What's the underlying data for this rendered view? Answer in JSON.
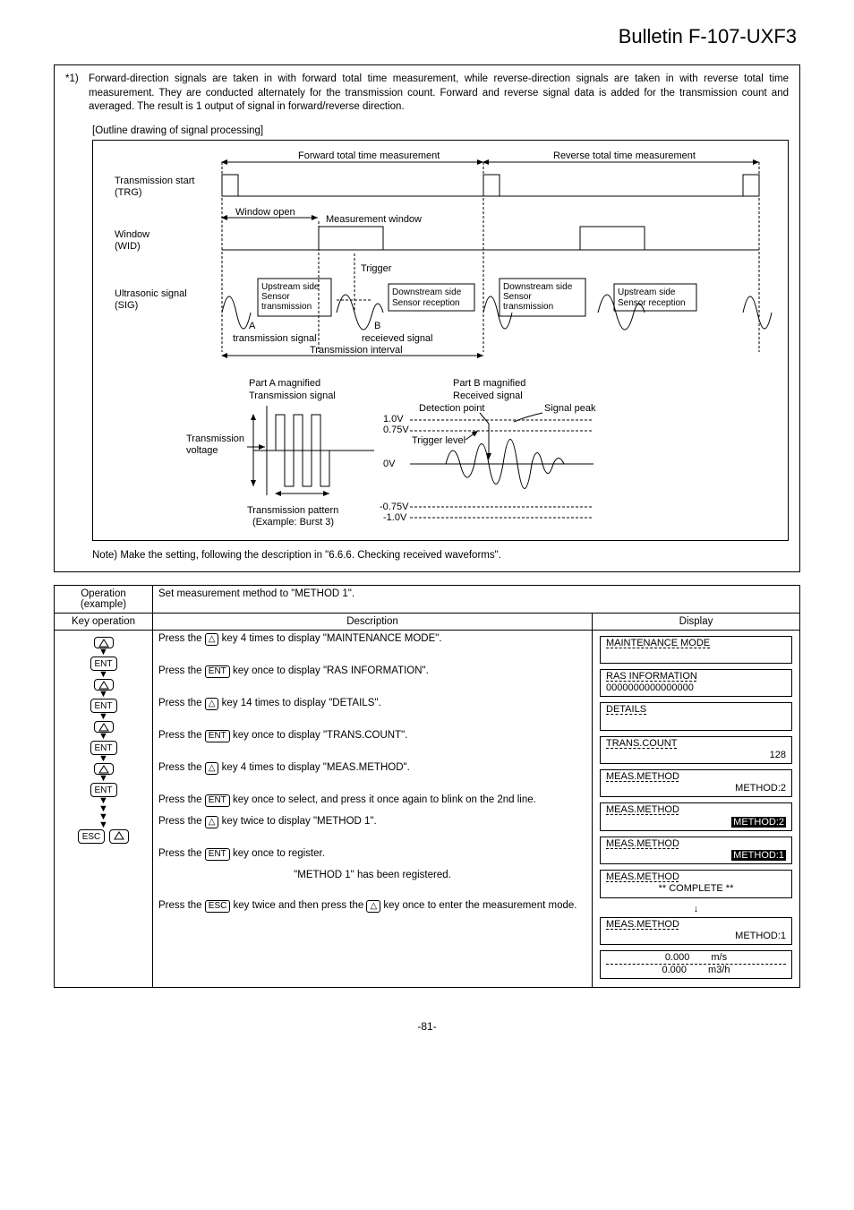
{
  "header": {
    "title": "Bulletin F-107-UXF3"
  },
  "note1": {
    "star": "*1)",
    "text": "Forward-direction signals are taken in with forward total time measurement, while reverse-direction signals are taken in with reverse total time measurement. They are conducted alternately for the transmission count. Forward and reverse signal data is added for the transmission count and averaged. The result is 1 output of signal in forward/reverse direction."
  },
  "outline_caption": "[Outline drawing of signal processing]",
  "diagram": {
    "fwd_total": "Forward total time measurement",
    "rev_total": "Reverse total time measurement",
    "trg_label": "Transmission start\n(TRG)",
    "wid_label": "Window\n(WID)",
    "sig_label": "Ultrasonic signal\n(SIG)",
    "window_open": "Window open",
    "meas_window": "Measurement window",
    "trigger": "Trigger",
    "up_sensor_tx": "Upstream side\nSensor\ntransmission",
    "dn_sensor_rx": "Downstream side\nSensor reception",
    "dn_sensor_tx": "Downstream side\nSensor\ntransmission",
    "up_sensor_rx": "Upstream side\nSensor reception",
    "a_label": "A\ntransmission signal",
    "b_label": "B\nreceieved signal",
    "trans_interval": "Transmission interval",
    "partA": "Part A magnified\nTransmission signal",
    "partB": "Part B magnified\nReceived signal",
    "tx_voltage": "Transmission\nvoltage",
    "tx_pattern": "Transmission pattern\n(Example: Burst 3)",
    "detection": "Detection point",
    "sig_peak": "Signal peak",
    "trig_level": "Trigger level",
    "v10": "1.0V",
    "v075": "0.75V",
    "v0": "0V",
    "vn075": "-0.75V",
    "vn10": "-1.0V"
  },
  "bottom_note": "Note) Make the setting, following the description in \"6.6.6. Checking received waveforms\".",
  "ops": {
    "operation_label": "Operation\n(example)",
    "set_method": "Set measurement method to \"METHOD 1\".",
    "key_op": "Key operation",
    "description": "Description",
    "display": "Display",
    "rows": [
      {
        "desc_pre": "Press the ",
        "desc_key": "△",
        "desc_post": " key 4 times to display \"MAINTENANCE MODE\".",
        "disp1": "MAINTENANCE MODE",
        "disp2": ""
      },
      {
        "desc_pre": "Press the ",
        "desc_key": "ENT",
        "desc_post": " key once to display \"RAS INFORMATION\".",
        "disp1": "RAS INFORMATION",
        "disp2": "0000000000000000"
      },
      {
        "desc_pre": "Press the ",
        "desc_key": "△",
        "desc_post": " key 14 times to display \"DETAILS\".",
        "disp1": "DETAILS",
        "disp2": ""
      },
      {
        "desc_pre": "Press the ",
        "desc_key": "ENT",
        "desc_post": " key once to display \"TRANS.COUNT\".",
        "disp1": "TRANS.COUNT",
        "disp2": "128"
      },
      {
        "desc_pre": "Press the ",
        "desc_key": "△",
        "desc_post": " key 4 times to display \"MEAS.METHOD\".",
        "disp1": "MEAS.METHOD",
        "disp2": "METHOD:2"
      },
      {
        "desc_pre": "Press the ",
        "desc_key": "ENT",
        "desc_post": " key once to select, and press it once again to blink on the 2nd line.",
        "disp1": "MEAS.METHOD",
        "disp2": "METHOD:2",
        "hl": true
      },
      {
        "desc_pre": "Press the ",
        "desc_key": "△",
        "desc_post": " key twice to display \"METHOD 1\".",
        "disp1": "MEAS.METHOD",
        "disp2": "METHOD:1",
        "hl": true
      },
      {
        "desc_pre": "Press the ",
        "desc_key": "ENT",
        "desc_post": " key once to register.",
        "disp1": "MEAS.METHOD",
        "disp2": "** COMPLETE **",
        "center": true
      },
      {
        "desc_center": "\"METHOD 1\" has been registered.",
        "disp1": "MEAS.METHOD",
        "disp2": "METHOD:1",
        "arrow": "↓"
      },
      {
        "desc_pre": "Press the ",
        "desc_key": "ESC",
        "desc_mid": " key twice and then press the ",
        "desc_key2": "△",
        "desc_post": " key once to enter the measurement mode.",
        "meas1": "0.000",
        "unit1": "m/s",
        "meas2": "0.000",
        "unit2": "m3/h"
      }
    ]
  },
  "page_num": "-81-"
}
